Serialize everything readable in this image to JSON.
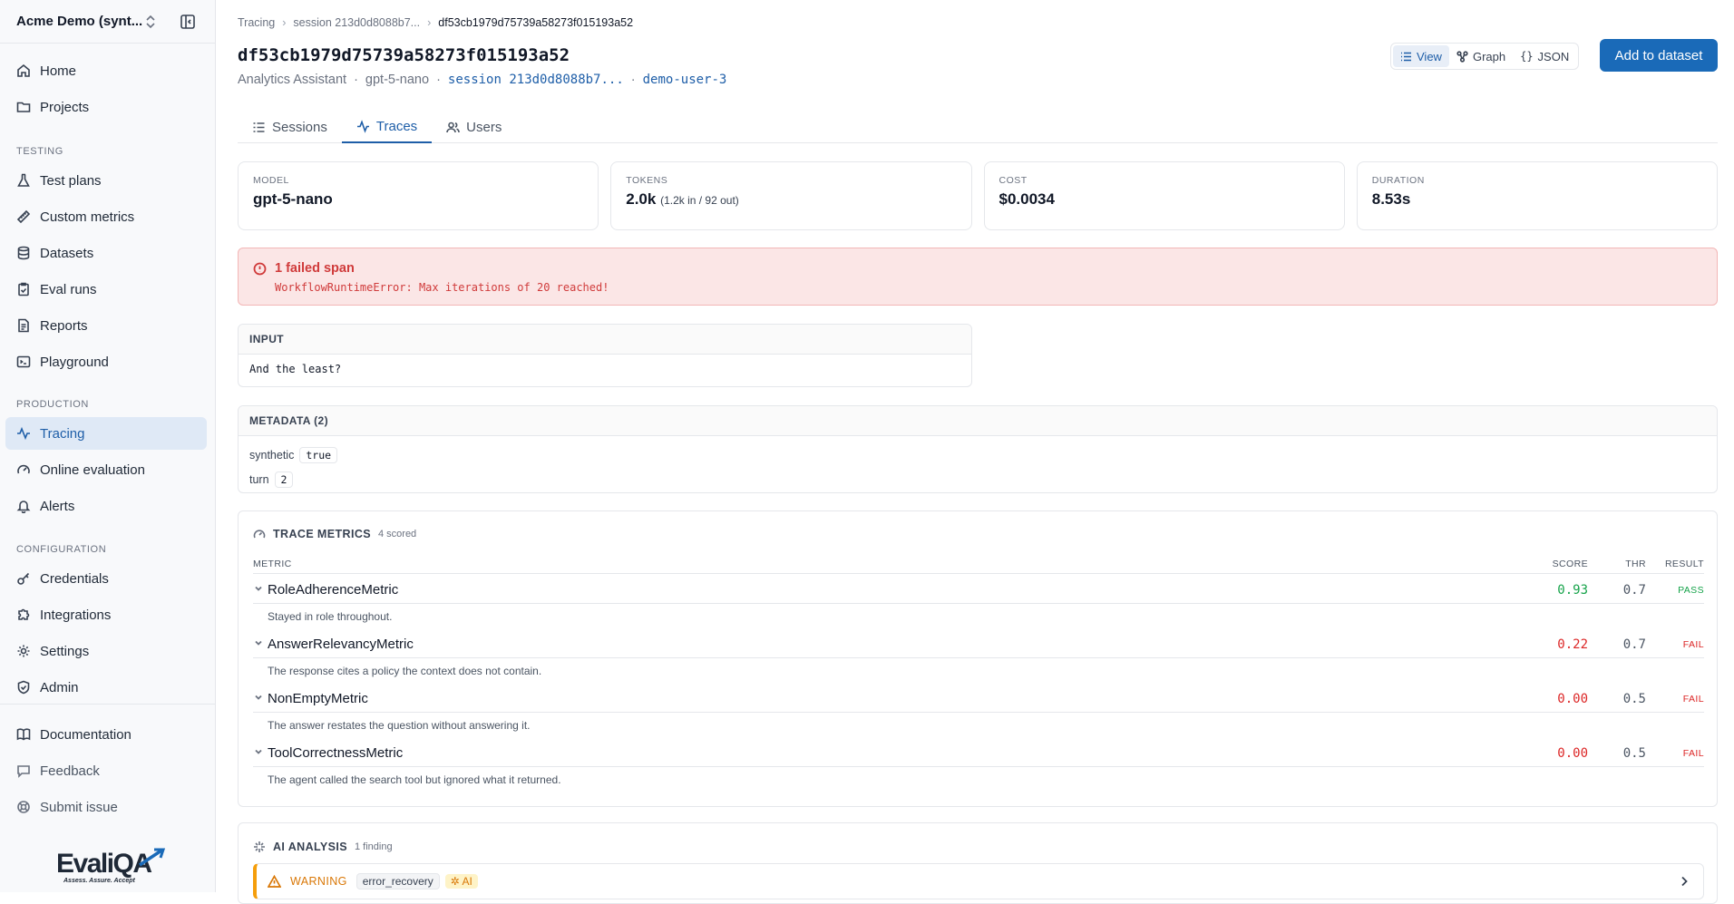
{
  "sidebar": {
    "org_name": "Acme Demo (synt...",
    "nav_top": [
      {
        "label": "Home",
        "icon": "home-icon"
      },
      {
        "label": "Projects",
        "icon": "folder-icon"
      }
    ],
    "section_testing": "TESTING",
    "nav_testing": [
      {
        "label": "Test plans",
        "icon": "flask-icon"
      },
      {
        "label": "Custom metrics",
        "icon": "ruler-icon"
      },
      {
        "label": "Datasets",
        "icon": "database-icon"
      },
      {
        "label": "Eval runs",
        "icon": "clipboard-check-icon"
      },
      {
        "label": "Reports",
        "icon": "file-text-icon"
      },
      {
        "label": "Playground",
        "icon": "terminal-icon"
      }
    ],
    "section_production": "PRODUCTION",
    "nav_production": [
      {
        "label": "Tracing",
        "icon": "activity-icon"
      },
      {
        "label": "Online evaluation",
        "icon": "gauge-icon"
      },
      {
        "label": "Alerts",
        "icon": "bell-icon"
      }
    ],
    "section_configuration": "CONFIGURATION",
    "nav_configuration": [
      {
        "label": "Credentials",
        "icon": "key-icon"
      },
      {
        "label": "Integrations",
        "icon": "puzzle-icon"
      },
      {
        "label": "Settings",
        "icon": "gear-icon"
      },
      {
        "label": "Admin",
        "icon": "shield-icon"
      }
    ],
    "nav_bottom": [
      {
        "label": "Documentation",
        "icon": "book-icon"
      },
      {
        "label": "Feedback",
        "icon": "message-icon"
      },
      {
        "label": "Submit issue",
        "icon": "lifebuoy-icon"
      }
    ],
    "logo_text": "EvaliQA",
    "logo_tagline": "Assess. Assure. Accept"
  },
  "breadcrumb": {
    "root": "Tracing",
    "session": "session 213d0d8088b7...",
    "current": "df53cb1979d75739a58273f015193a52"
  },
  "header": {
    "title": "df53cb1979d75739a58273f015193a52",
    "app": "Analytics Assistant",
    "model": "gpt-5-nano",
    "session_link": "session 213d0d8088b7...",
    "user_link": "demo-user-3",
    "view_options": [
      "View",
      "Graph",
      "JSON"
    ],
    "selected_view": "View",
    "add_button": "Add to dataset"
  },
  "tabs": [
    "Sessions",
    "Traces",
    "Users"
  ],
  "active_tab": "Traces",
  "stats": [
    {
      "label": "MODEL",
      "value": "gpt-5-nano",
      "sub": ""
    },
    {
      "label": "TOKENS",
      "value": "2.0k",
      "sub": "(1.2k in / 92 out)"
    },
    {
      "label": "COST",
      "value": "$0.0034",
      "sub": ""
    },
    {
      "label": "DURATION",
      "value": "8.53s",
      "sub": ""
    }
  ],
  "error": {
    "title": "1 failed span",
    "message": "WorkflowRuntimeError: Max iterations of 20 reached!"
  },
  "input": {
    "label": "INPUT",
    "text": "And the least?"
  },
  "metadata": {
    "label": "METADATA (2)",
    "items": [
      {
        "key": "synthetic",
        "value": "true"
      },
      {
        "key": "turn",
        "value": "2"
      }
    ]
  },
  "trace_metrics": {
    "title": "TRACE METRICS",
    "count": "4 scored",
    "columns": [
      "METRIC",
      "SCORE",
      "THR",
      "RESULT"
    ],
    "rows": [
      {
        "name": "RoleAdherenceMetric",
        "score": "0.93",
        "thr": "0.7",
        "result": "PASS",
        "desc": "Stayed in role throughout."
      },
      {
        "name": "AnswerRelevancyMetric",
        "score": "0.22",
        "thr": "0.7",
        "result": "FAIL",
        "desc": "The response cites a policy the context does not contain."
      },
      {
        "name": "NonEmptyMetric",
        "score": "0.00",
        "thr": "0.5",
        "result": "FAIL",
        "desc": "The answer restates the question without answering it."
      },
      {
        "name": "ToolCorrectnessMetric",
        "score": "0.00",
        "thr": "0.5",
        "result": "FAIL",
        "desc": "The agent called the search tool but ignored what it returned."
      }
    ]
  },
  "ai_analysis": {
    "title": "AI ANALYSIS",
    "count": "1 finding",
    "finding": {
      "severity": "WARNING",
      "tag": "error_recovery",
      "ai_label": "AI"
    }
  },
  "colors": {
    "accent": "#1a6ab8",
    "pass": "#16a34a",
    "fail": "#dc2626",
    "warning": "#d97706",
    "error_bg": "#fbe6e6"
  }
}
